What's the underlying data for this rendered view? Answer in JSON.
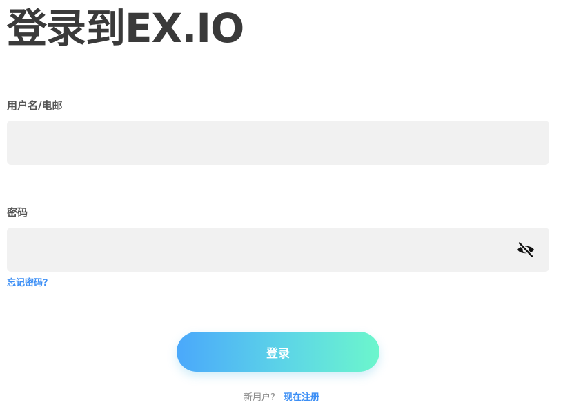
{
  "title": "登录到EX.IO",
  "form": {
    "username": {
      "label": "用户名/电邮",
      "value": "",
      "placeholder": ""
    },
    "password": {
      "label": "密码",
      "value": "",
      "placeholder": "",
      "toggle_icon": "eye-off-icon"
    },
    "forgot_password": "忘记密码?",
    "login_button": "登录"
  },
  "signup": {
    "prompt": "新用户?",
    "link": "现在注册"
  },
  "colors": {
    "accent": "#3d8ff5",
    "button_gradient_start": "#4aa8fb",
    "button_gradient_end": "#6cf6cc",
    "field_background": "#f1f1f1"
  }
}
